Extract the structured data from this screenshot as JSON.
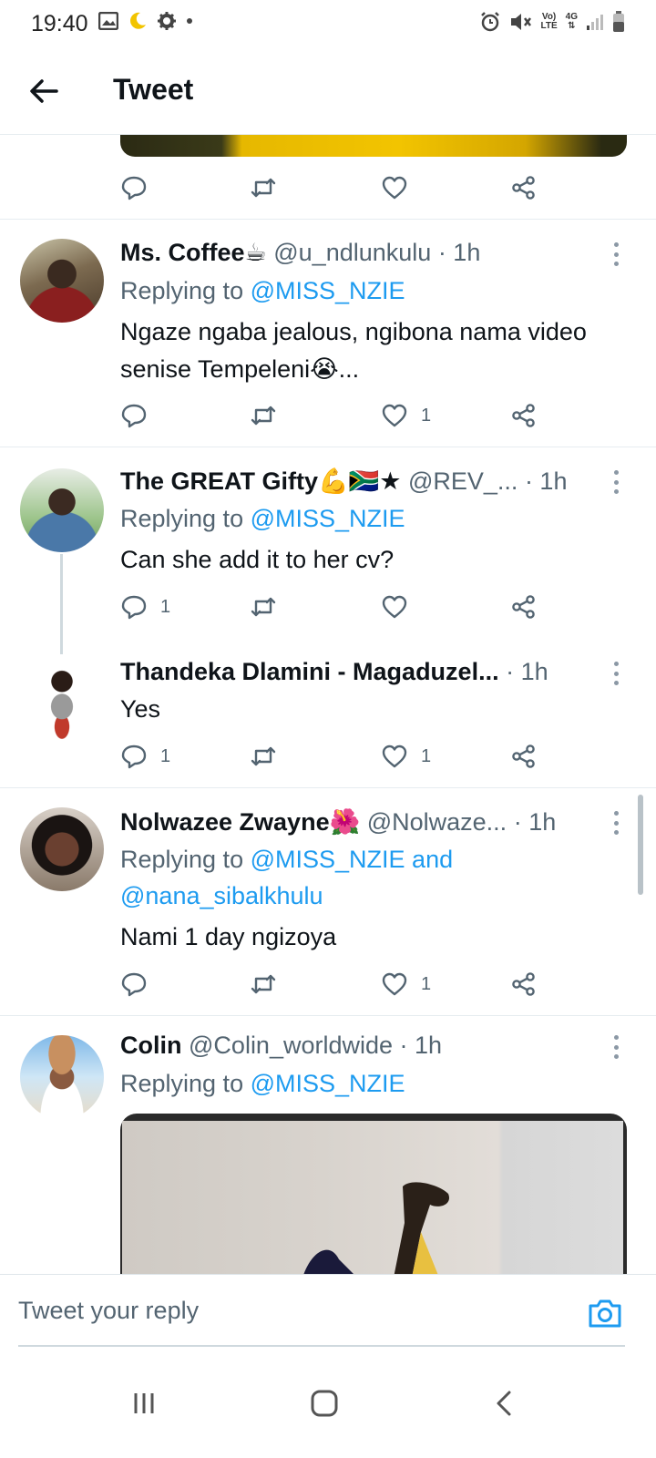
{
  "status_bar": {
    "time": "19:40",
    "volte": "Vo)",
    "lte": "LTE",
    "net": "4G"
  },
  "header": {
    "title": "Tweet"
  },
  "reply_prefix": "Replying to",
  "tweets": [
    {
      "name": "Ms. Coffee☕",
      "handle": "@u_ndlunkulu",
      "time": "· 1h",
      "mention": "@MISS_NZIE",
      "text": "Ngaze ngaba jealous, ngibona nama video senise Tempeleni😭...",
      "replies": "",
      "retweets": "",
      "likes": "1"
    },
    {
      "name": "The GREAT Gifty💪🇿🇦★",
      "handle": "@REV_...",
      "time": "· 1h",
      "mention": "@MISS_NZIE",
      "text": "Can she add it to her cv?",
      "replies": "1",
      "retweets": "",
      "likes": ""
    },
    {
      "name": "Thandeka Dlamini - Magaduzel...",
      "handle": "",
      "time": "· 1h",
      "text": "Yes",
      "replies": "1",
      "retweets": "",
      "likes": "1"
    },
    {
      "name": "Nolwazee Zwayne🌺",
      "handle": "@Nolwaze...",
      "time": "· 1h",
      "mention": "@MISS_NZIE and",
      "mention2": "@nana_sibalkhulu",
      "text": "Nami 1 day ngizoya",
      "replies": "",
      "retweets": "",
      "likes": "1"
    },
    {
      "name": "Colin",
      "handle": "@Colin_worldwide",
      "time": "· 1h",
      "mention": "@MISS_NZIE"
    }
  ],
  "reply_bar": {
    "placeholder": "Tweet your reply"
  },
  "icons": {
    "back": "arrow-left-icon",
    "reply": "comment-icon",
    "retweet": "retweet-icon",
    "like": "heart-icon",
    "share": "share-icon",
    "camera": "camera-icon",
    "more": "more-vertical-icon"
  },
  "colors": {
    "accent": "#1d9bf0",
    "text": "#0f1419",
    "muted": "#536471"
  }
}
